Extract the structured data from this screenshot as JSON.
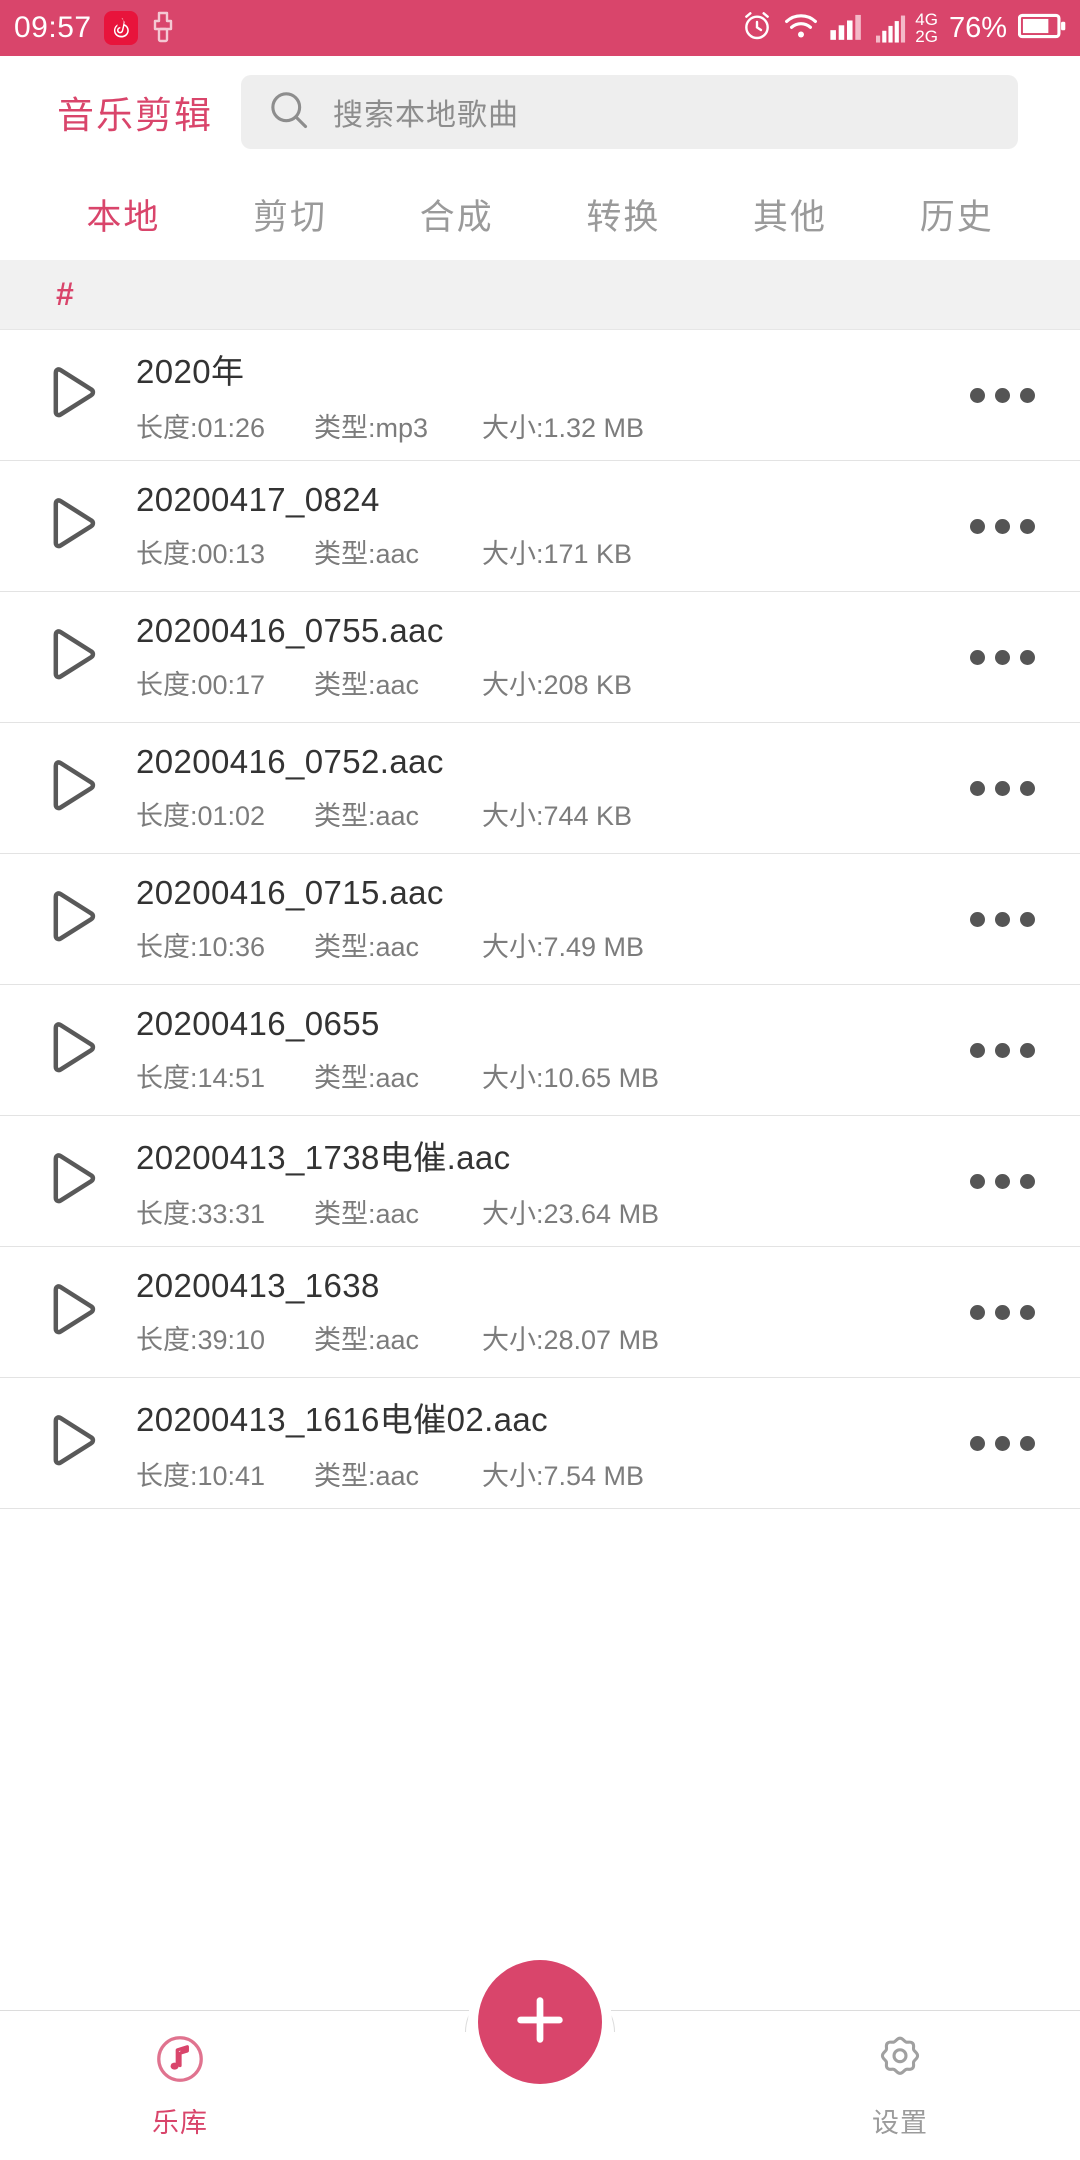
{
  "status_bar": {
    "time": "09:57",
    "battery_percent": "76%",
    "network_primary": "4G",
    "network_secondary": "2G",
    "icons": [
      "netease-music-icon",
      "usb-icon",
      "alarm-icon",
      "wifi-icon",
      "signal-icon",
      "dual-sim-icon",
      "battery-icon"
    ],
    "background_color": "#d9456b",
    "foreground_color": "#ffffff"
  },
  "header": {
    "app_title": "音乐剪辑",
    "search_placeholder": "搜索本地歌曲"
  },
  "tabs": [
    {
      "label": "本地",
      "active": true
    },
    {
      "label": "剪切",
      "active": false
    },
    {
      "label": "合成",
      "active": false
    },
    {
      "label": "转换",
      "active": false
    },
    {
      "label": "其他",
      "active": false
    },
    {
      "label": "历史",
      "active": false
    }
  ],
  "section_header": {
    "label": "#"
  },
  "list": {
    "labels": {
      "length": "长度:",
      "type": "类型:",
      "size": "大小:"
    },
    "items": [
      {
        "title": "2020年",
        "length": "长度:01:26",
        "type": "类型:mp3",
        "size": "大小:1.32 MB"
      },
      {
        "title": "20200417_0824",
        "length": "长度:00:13",
        "type": "类型:aac",
        "size": "大小:171 KB"
      },
      {
        "title": "20200416_0755.aac",
        "length": "长度:00:17",
        "type": "类型:aac",
        "size": "大小:208 KB"
      },
      {
        "title": "20200416_0752.aac",
        "length": "长度:01:02",
        "type": "类型:aac",
        "size": "大小:744 KB"
      },
      {
        "title": "20200416_0715.aac",
        "length": "长度:10:36",
        "type": "类型:aac",
        "size": "大小:7.49 MB"
      },
      {
        "title": "20200416_0655",
        "length": "长度:14:51",
        "type": "类型:aac",
        "size": "大小:10.65 MB"
      },
      {
        "title": "20200413_1738电催.aac",
        "length": "长度:33:31",
        "type": "类型:aac",
        "size": "大小:23.64 MB"
      },
      {
        "title": "20200413_1638",
        "length": "长度:39:10",
        "type": "类型:aac",
        "size": "大小:28.07 MB"
      },
      {
        "title": "20200413_1616电催02.aac",
        "length": "长度:10:41",
        "type": "类型:aac",
        "size": "大小:7.54 MB"
      }
    ]
  },
  "bottom_nav": {
    "items": [
      {
        "label": "乐库",
        "icon": "music-note-icon",
        "active": true
      },
      {
        "label": "设置",
        "icon": "gear-icon",
        "active": false
      }
    ],
    "fab": {
      "icon": "plus-icon"
    }
  },
  "colors": {
    "accent": "#d9456b",
    "muted_text": "#9a9a9a",
    "title_text": "#333333",
    "search_bg": "#eeeeee"
  }
}
